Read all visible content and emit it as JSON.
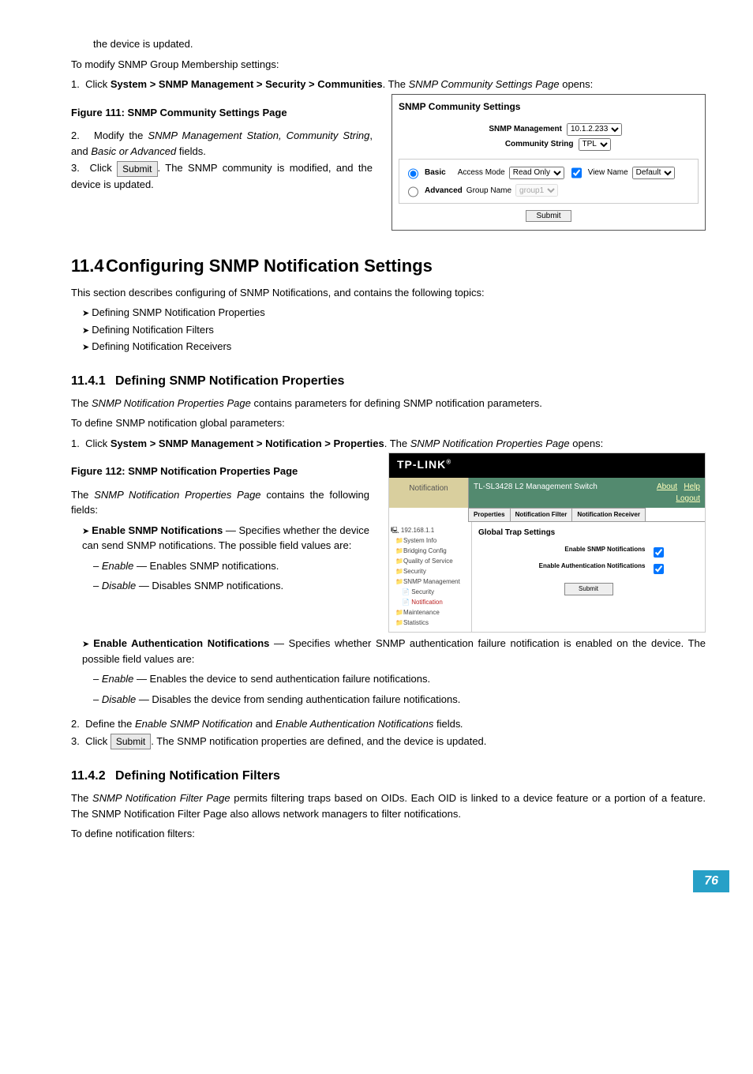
{
  "top_text": "the device is updated.",
  "modify_intro": "To modify SNMP Group Membership settings:",
  "step1a": "Click ",
  "step1b": "System > SNMP Management > Security > Communities",
  "step1c": ". The ",
  "step1d": "SNMP Community Settings Page",
  "step1e": " opens:",
  "fig111_caption": "Figure 111: SNMP Community Settings Page",
  "step2a": "Modify the ",
  "step2b": "SNMP Management Station, Community String",
  "step2c": ", and ",
  "step2d": "Basic or Advanced",
  "step2e": " fields.",
  "step3a": "Click ",
  "step3b": ". The SNMP community is modified, and the device is updated.",
  "submit_label": "Submit",
  "fig111": {
    "title": "SNMP Community Settings",
    "mgmt_label": "SNMP Management",
    "mgmt_value": "10.1.2.233",
    "cs_label": "Community String",
    "cs_value": "TPL",
    "basic": "Basic",
    "access_label": "Access Mode",
    "access_value": "Read Only",
    "viewname_label": "View Name",
    "viewname_value": "Default",
    "advanced": "Advanced",
    "group_label": "Group Name",
    "group_value": "group1",
    "submit": "Submit"
  },
  "h2_num": "11.4",
  "h2_title": "Configuring SNMP Notification Settings",
  "h2_intro": "This section describes configuring of SNMP Notifications, and contains the following topics:",
  "h2_items": {
    "a": "Defining SNMP Notification Properties",
    "b": "Defining Notification Filters",
    "c": "Defining Notification Receivers"
  },
  "h3a_num": "11.4.1",
  "h3a_title": "Defining SNMP Notification Properties",
  "h3a_p1a": "The ",
  "h3a_p1b": "SNMP Notification Properties Page",
  "h3a_p1c": " contains parameters for defining SNMP notification parameters.",
  "h3a_p2": "To define SNMP notification global parameters:",
  "h3a_s1a": "Click ",
  "h3a_s1b": "System > SNMP Management > Notification > Properties",
  "h3a_s1c": ". The ",
  "h3a_s1d": "SNMP Notification Properties Page",
  "h3a_s1e": " opens:",
  "fig112_caption": "Figure 112: SNMP Notification Properties Page",
  "h3a_desc_a": "The ",
  "h3a_desc_b": "SNMP Notification Properties Page",
  "h3a_desc_c": " contains the following fields:",
  "bul1a": "Enable SNMP Notifications",
  "bul1b": " — Specifies whether the device can send SNMP notifications. The possible field values are:",
  "bul1_e1a": "Enable",
  "bul1_e1b": " — Enables SNMP notifications.",
  "bul1_e2a": "Disable",
  "bul1_e2b": " — Disables SNMP notifications.",
  "bul2a": "Enable Authentication Notifications",
  "bul2b": " — Specifies whether SNMP authentication failure notification is enabled on the device. The possible field values are:",
  "bul2_e1a": "Enable",
  "bul2_e1b": " — Enables the device to send authentication failure notifications.",
  "bul2_e2a": "Disable",
  "bul2_e2b": " — Disables the device from sending authentication failure notifications.",
  "h3a_s2a": "Define the ",
  "h3a_s2b": "Enable SNMP Notification",
  "h3a_s2c": " and ",
  "h3a_s2d": "Enable Authentication Notifications",
  "h3a_s2e": " fields",
  "h3a_s2f": ".",
  "h3a_s3a": "Click ",
  "h3a_s3b": ". The SNMP notification properties are defined, and the device is updated.",
  "fig112": {
    "logo": "TP-LINK",
    "nav": "Notification",
    "device": "TL-SL3428 L2 Management Switch",
    "about": "About",
    "help": "Help",
    "logout": "Logout",
    "tab1": "Properties",
    "tab2": "Notification Filter",
    "tab3": "Notification Receiver",
    "ip": "192.168.1.1",
    "tree": {
      "a": "System Info",
      "b": "Bridging Config",
      "c": "Quality of Service",
      "d": "Security",
      "e": "SNMP Management",
      "f": "Security",
      "g": "Notification",
      "h": "Maintenance",
      "i": "Statistics"
    },
    "main_title": "Global Trap Settings",
    "f1": "Enable SNMP Notifications",
    "f2": "Enable Authentication Notifications",
    "submit": "Submit"
  },
  "h3b_num": "11.4.2",
  "h3b_title": "Defining Notification Filters",
  "h3b_p1a": "The ",
  "h3b_p1b": "SNMP Notification Filter Page",
  "h3b_p1c": " permits filtering traps based on OIDs. Each OID is linked to a device feature or a portion of a feature. The SNMP Notification Filter Page also allows network managers to filter notifications.",
  "h3b_p2": "To define notification filters:",
  "page_number": "76"
}
